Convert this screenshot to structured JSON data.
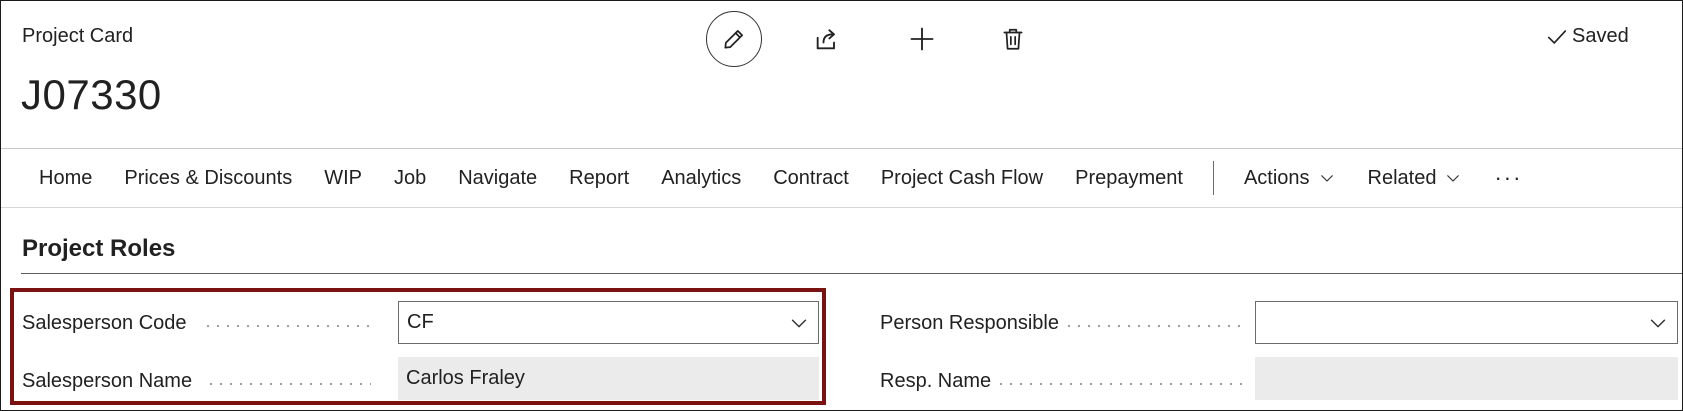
{
  "header": {
    "caption": "Project Card",
    "record_no": "J07330",
    "status": "Saved",
    "icons": {
      "edit": "pencil-icon",
      "share": "share-icon",
      "new": "plus-icon",
      "delete": "trash-icon",
      "saved": "checkmark-icon"
    }
  },
  "action_bar": {
    "items": [
      {
        "label": "Home"
      },
      {
        "label": "Prices & Discounts"
      },
      {
        "label": "WIP"
      },
      {
        "label": "Job"
      },
      {
        "label": "Navigate"
      },
      {
        "label": "Report"
      },
      {
        "label": "Analytics"
      },
      {
        "label": "Contract"
      },
      {
        "label": "Project Cash Flow"
      },
      {
        "label": "Prepayment"
      }
    ],
    "actions_label": "Actions",
    "related_label": "Related",
    "more_label": "···"
  },
  "section": {
    "title": "Project Roles",
    "highlight_color": "#7a1212",
    "fields": {
      "salesperson_code": {
        "label": "Salesperson Code",
        "value": "CF"
      },
      "salesperson_name": {
        "label": "Salesperson Name",
        "value": "Carlos Fraley"
      },
      "person_responsible": {
        "label": "Person Responsible",
        "value": ""
      },
      "resp_name": {
        "label": "Resp. Name",
        "value": ""
      }
    }
  }
}
